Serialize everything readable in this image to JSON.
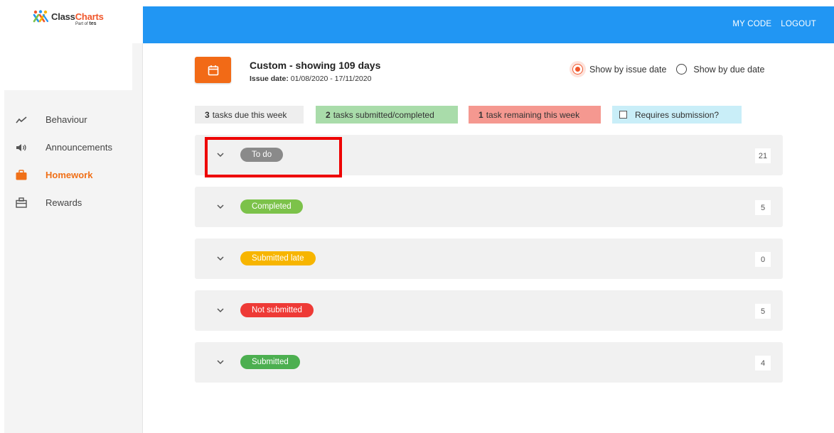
{
  "brand": {
    "name_part1": "Class",
    "name_part2": "Charts",
    "sub_prefix": "Part of",
    "sub_brand": "tes",
    "colors": {
      "orange": "#f0562b",
      "blue": "#2196f3"
    }
  },
  "topbar": {
    "links": [
      "MY CODE",
      "LOGOUT"
    ]
  },
  "sidebar": {
    "items": [
      {
        "label": "Behaviour",
        "icon": "trend-line-icon",
        "active": false
      },
      {
        "label": "Announcements",
        "icon": "speaker-icon",
        "active": false
      },
      {
        "label": "Homework",
        "icon": "briefcase-icon",
        "active": true
      },
      {
        "label": "Rewards",
        "icon": "gift-box-icon",
        "active": false
      }
    ]
  },
  "date_range": {
    "title": "Custom - showing 109 days",
    "issue_label": "Issue date:",
    "issue_value": "01/08/2020 - 17/11/2020"
  },
  "filter": {
    "by_issue": "Show by issue date",
    "by_due": "Show by due date",
    "selected": "by_issue"
  },
  "summary": {
    "due_count": "3",
    "due_text": "tasks due this week",
    "submitted_count": "2",
    "submitted_text": "tasks submitted/completed",
    "remaining_count": "1",
    "remaining_text": "task remaining this week",
    "requires_submission": "Requires submission?"
  },
  "groups": [
    {
      "label": "To do",
      "count": "21",
      "color": "#8a8a8a"
    },
    {
      "label": "Completed",
      "count": "5",
      "color": "#7cc24a"
    },
    {
      "label": "Submitted late",
      "count": "0",
      "color": "#f7b500"
    },
    {
      "label": "Not submitted",
      "count": "5",
      "color": "#ee3a36"
    },
    {
      "label": "Submitted",
      "count": "4",
      "color": "#4caf50"
    }
  ]
}
